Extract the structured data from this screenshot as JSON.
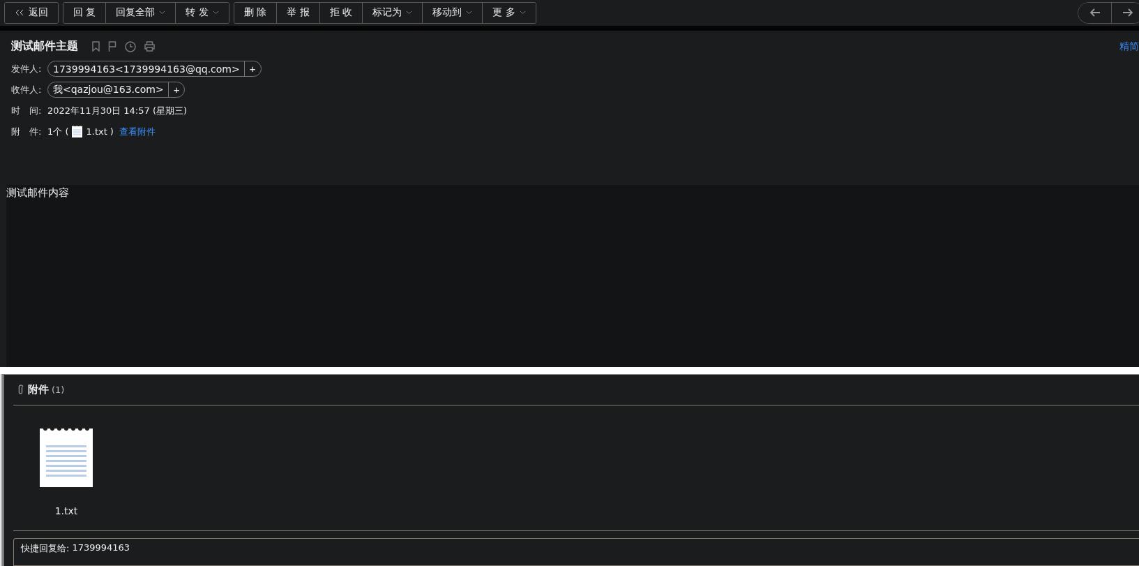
{
  "toolbar": {
    "groups": [
      {
        "buttons": [
          {
            "label": "返回",
            "kind": "back",
            "dropdown": false
          }
        ]
      },
      {
        "buttons": [
          {
            "label": "回 复",
            "kind": "plain",
            "dropdown": false
          },
          {
            "label": "回复全部",
            "kind": "plain",
            "dropdown": true
          },
          {
            "label": "转 发",
            "kind": "plain",
            "dropdown": true
          }
        ]
      },
      {
        "buttons": [
          {
            "label": "删 除",
            "kind": "plain",
            "dropdown": false
          },
          {
            "label": "举 报",
            "kind": "plain",
            "dropdown": false
          },
          {
            "label": "拒 收",
            "kind": "plain",
            "dropdown": false
          },
          {
            "label": "标记为",
            "kind": "plain",
            "dropdown": true
          },
          {
            "label": "移动到",
            "kind": "plain",
            "dropdown": true
          },
          {
            "label": "更 多",
            "kind": "plain",
            "dropdown": true
          }
        ]
      }
    ]
  },
  "header": {
    "subject": "测试邮件主题",
    "view_link": "精简",
    "fields": [
      {
        "label": "发件人:",
        "kind": "contact",
        "value": "1739994163<1739994163@qq.com>",
        "add": "+"
      },
      {
        "label": "收件人:",
        "kind": "contact",
        "value": "我<qazjou@163.com>",
        "add": "+"
      },
      {
        "label": "时　间:",
        "kind": "text",
        "value": "2022年11月30日 14:57 (星期三)"
      },
      {
        "label": "附　件:",
        "kind": "attachment",
        "count": "1个 (",
        "file": "1.txt",
        "close": ")",
        "link": "查看附件"
      }
    ]
  },
  "body": {
    "text": "测试邮件内容"
  },
  "attachments": {
    "title": "附件",
    "count": "(1)",
    "files": [
      {
        "name": "1.txt"
      }
    ]
  },
  "quick_reply": {
    "label": "快捷回复给:",
    "recipient": "1739994163"
  }
}
